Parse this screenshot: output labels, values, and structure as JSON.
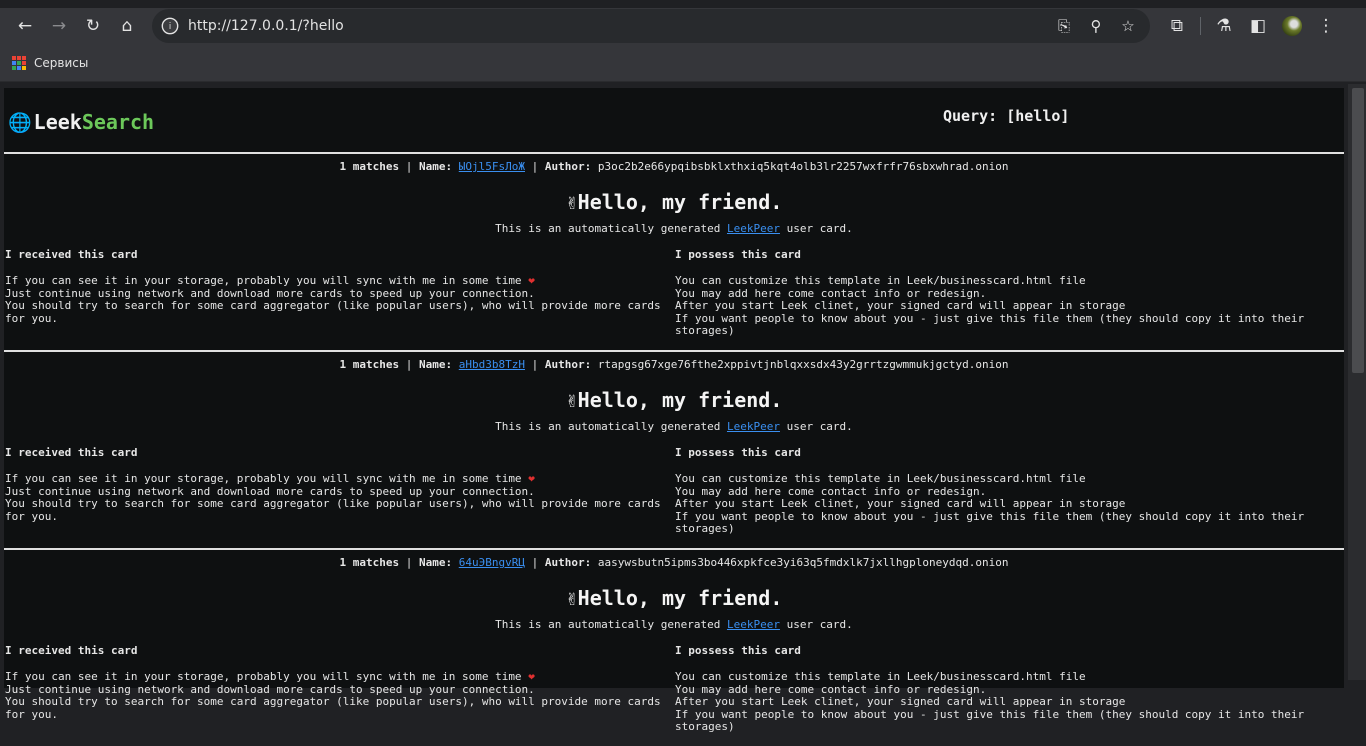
{
  "browser": {
    "url": "http://127.0.0.1/?hello",
    "bookmark_label": "Сервисы"
  },
  "header": {
    "logo_leek": "Leek",
    "logo_search": "Search",
    "query_label": "Query: [hello]"
  },
  "cards": [
    {
      "matches": "1 matches",
      "name_label": "Name:",
      "name": "ЫOjl5FsЛoЖ",
      "author_label": "Author:",
      "author": "p3oc2b2e66ypqibsbklxthxiq5kqt4olb3lr2257wxfrfr76sbxwhrad.onion"
    },
    {
      "matches": "1 matches",
      "name_label": "Name:",
      "name": "aHbd3b8TzH",
      "author_label": "Author:",
      "author": "rtapgsg67xge76fthe2xppivtjnblqxxsdx43y2grrtzgwmmukjgctyd.onion"
    },
    {
      "matches": "1 matches",
      "name_label": "Name:",
      "name": "64uЭBngvRЦ",
      "author_label": "Author:",
      "author": "aasywsbutn5ipms3bo446xpkfce3yi63q5fmdxlk7jxllhgploneydqd.onion"
    }
  ],
  "card_template": {
    "title": "✌Hello, my friend.",
    "subtitle_pre": "This is an automatically generated ",
    "subtitle_link": "LeekPeer",
    "subtitle_post": " user card.",
    "left_heading": "I received this card",
    "left_lines": [
      "If you can see it in your storage, probably you will sync with me in some time ",
      "Just continue using network and download more cards to speed up your connection.",
      "You should try to search for some card aggregator (like popular users), who will provide more cards for you."
    ],
    "heart": "❤",
    "right_heading": "I possess this card",
    "right_lines": [
      "You can customize this template in Leek/businesscard.html file",
      "You may add here come contact info or redesign.",
      "After you start Leek clinet, your signed card will appear in storage",
      "If you want people to know about you - just give this file them (they should copy it into their storages)"
    ]
  }
}
